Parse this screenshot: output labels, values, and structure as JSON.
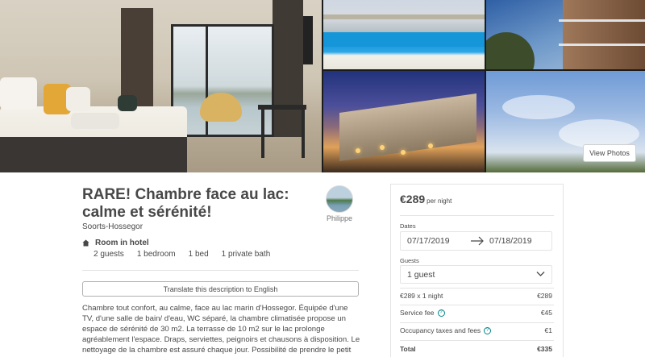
{
  "gallery": {
    "view_photos_label": "View Photos"
  },
  "listing": {
    "title": "RARE! Chambre face au lac: calme et sérénité!",
    "location": "Soorts-Hossegor",
    "host_name": "Philippe",
    "room_type": "Room in hotel",
    "facts": [
      "2 guests",
      "1 bedroom",
      "1 bed",
      "1 private bath"
    ],
    "translate_label": "Translate this description to English",
    "description": "Chambre tout confort, au calme, face au lac marin d'Hossegor. Équipée d'une TV, d'une salle de bain/ d'eau, WC séparé, la chambre climatisée propose un espace de sérénité de 30 m2. La terrasse de 10 m2 sur le lac prolonge agréablement l'espace. Draps, serviettes, peignoirs et chausons à disposition. Le nettoyage de la chambre est assuré chaque jour. Possibilité de prendre le petit déjeuner en"
  },
  "booking": {
    "price": "€289",
    "per_night": "per night",
    "dates_label": "Dates",
    "check_in": "07/17/2019",
    "check_out": "07/18/2019",
    "guests_label": "Guests",
    "guests_value": "1 guest",
    "lines": [
      {
        "label": "€289 x 1 night",
        "value": "€289",
        "info": false
      },
      {
        "label": "Service fee",
        "value": "€45",
        "info": true
      },
      {
        "label": "Occupancy taxes and fees",
        "value": "€1",
        "info": true
      }
    ],
    "total_label": "Total",
    "total_value": "€335"
  },
  "colors": {
    "text": "#484848",
    "accent": "#008489",
    "border": "#e4e4e4"
  },
  "icons": [
    "home-icon",
    "arrow-right-icon",
    "chevron-down-icon",
    "info-icon"
  ]
}
